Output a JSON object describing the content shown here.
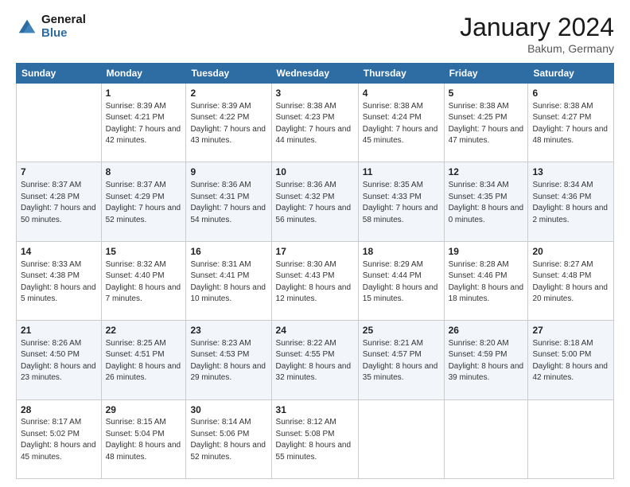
{
  "header": {
    "logo_line1": "General",
    "logo_line2": "Blue",
    "month": "January 2024",
    "location": "Bakum, Germany"
  },
  "weekdays": [
    "Sunday",
    "Monday",
    "Tuesday",
    "Wednesday",
    "Thursday",
    "Friday",
    "Saturday"
  ],
  "weeks": [
    [
      {
        "day": "",
        "sunrise": "",
        "sunset": "",
        "daylight": ""
      },
      {
        "day": "1",
        "sunrise": "Sunrise: 8:39 AM",
        "sunset": "Sunset: 4:21 PM",
        "daylight": "Daylight: 7 hours and 42 minutes."
      },
      {
        "day": "2",
        "sunrise": "Sunrise: 8:39 AM",
        "sunset": "Sunset: 4:22 PM",
        "daylight": "Daylight: 7 hours and 43 minutes."
      },
      {
        "day": "3",
        "sunrise": "Sunrise: 8:38 AM",
        "sunset": "Sunset: 4:23 PM",
        "daylight": "Daylight: 7 hours and 44 minutes."
      },
      {
        "day": "4",
        "sunrise": "Sunrise: 8:38 AM",
        "sunset": "Sunset: 4:24 PM",
        "daylight": "Daylight: 7 hours and 45 minutes."
      },
      {
        "day": "5",
        "sunrise": "Sunrise: 8:38 AM",
        "sunset": "Sunset: 4:25 PM",
        "daylight": "Daylight: 7 hours and 47 minutes."
      },
      {
        "day": "6",
        "sunrise": "Sunrise: 8:38 AM",
        "sunset": "Sunset: 4:27 PM",
        "daylight": "Daylight: 7 hours and 48 minutes."
      }
    ],
    [
      {
        "day": "7",
        "sunrise": "Sunrise: 8:37 AM",
        "sunset": "Sunset: 4:28 PM",
        "daylight": "Daylight: 7 hours and 50 minutes."
      },
      {
        "day": "8",
        "sunrise": "Sunrise: 8:37 AM",
        "sunset": "Sunset: 4:29 PM",
        "daylight": "Daylight: 7 hours and 52 minutes."
      },
      {
        "day": "9",
        "sunrise": "Sunrise: 8:36 AM",
        "sunset": "Sunset: 4:31 PM",
        "daylight": "Daylight: 7 hours and 54 minutes."
      },
      {
        "day": "10",
        "sunrise": "Sunrise: 8:36 AM",
        "sunset": "Sunset: 4:32 PM",
        "daylight": "Daylight: 7 hours and 56 minutes."
      },
      {
        "day": "11",
        "sunrise": "Sunrise: 8:35 AM",
        "sunset": "Sunset: 4:33 PM",
        "daylight": "Daylight: 7 hours and 58 minutes."
      },
      {
        "day": "12",
        "sunrise": "Sunrise: 8:34 AM",
        "sunset": "Sunset: 4:35 PM",
        "daylight": "Daylight: 8 hours and 0 minutes."
      },
      {
        "day": "13",
        "sunrise": "Sunrise: 8:34 AM",
        "sunset": "Sunset: 4:36 PM",
        "daylight": "Daylight: 8 hours and 2 minutes."
      }
    ],
    [
      {
        "day": "14",
        "sunrise": "Sunrise: 8:33 AM",
        "sunset": "Sunset: 4:38 PM",
        "daylight": "Daylight: 8 hours and 5 minutes."
      },
      {
        "day": "15",
        "sunrise": "Sunrise: 8:32 AM",
        "sunset": "Sunset: 4:40 PM",
        "daylight": "Daylight: 8 hours and 7 minutes."
      },
      {
        "day": "16",
        "sunrise": "Sunrise: 8:31 AM",
        "sunset": "Sunset: 4:41 PM",
        "daylight": "Daylight: 8 hours and 10 minutes."
      },
      {
        "day": "17",
        "sunrise": "Sunrise: 8:30 AM",
        "sunset": "Sunset: 4:43 PM",
        "daylight": "Daylight: 8 hours and 12 minutes."
      },
      {
        "day": "18",
        "sunrise": "Sunrise: 8:29 AM",
        "sunset": "Sunset: 4:44 PM",
        "daylight": "Daylight: 8 hours and 15 minutes."
      },
      {
        "day": "19",
        "sunrise": "Sunrise: 8:28 AM",
        "sunset": "Sunset: 4:46 PM",
        "daylight": "Daylight: 8 hours and 18 minutes."
      },
      {
        "day": "20",
        "sunrise": "Sunrise: 8:27 AM",
        "sunset": "Sunset: 4:48 PM",
        "daylight": "Daylight: 8 hours and 20 minutes."
      }
    ],
    [
      {
        "day": "21",
        "sunrise": "Sunrise: 8:26 AM",
        "sunset": "Sunset: 4:50 PM",
        "daylight": "Daylight: 8 hours and 23 minutes."
      },
      {
        "day": "22",
        "sunrise": "Sunrise: 8:25 AM",
        "sunset": "Sunset: 4:51 PM",
        "daylight": "Daylight: 8 hours and 26 minutes."
      },
      {
        "day": "23",
        "sunrise": "Sunrise: 8:23 AM",
        "sunset": "Sunset: 4:53 PM",
        "daylight": "Daylight: 8 hours and 29 minutes."
      },
      {
        "day": "24",
        "sunrise": "Sunrise: 8:22 AM",
        "sunset": "Sunset: 4:55 PM",
        "daylight": "Daylight: 8 hours and 32 minutes."
      },
      {
        "day": "25",
        "sunrise": "Sunrise: 8:21 AM",
        "sunset": "Sunset: 4:57 PM",
        "daylight": "Daylight: 8 hours and 35 minutes."
      },
      {
        "day": "26",
        "sunrise": "Sunrise: 8:20 AM",
        "sunset": "Sunset: 4:59 PM",
        "daylight": "Daylight: 8 hours and 39 minutes."
      },
      {
        "day": "27",
        "sunrise": "Sunrise: 8:18 AM",
        "sunset": "Sunset: 5:00 PM",
        "daylight": "Daylight: 8 hours and 42 minutes."
      }
    ],
    [
      {
        "day": "28",
        "sunrise": "Sunrise: 8:17 AM",
        "sunset": "Sunset: 5:02 PM",
        "daylight": "Daylight: 8 hours and 45 minutes."
      },
      {
        "day": "29",
        "sunrise": "Sunrise: 8:15 AM",
        "sunset": "Sunset: 5:04 PM",
        "daylight": "Daylight: 8 hours and 48 minutes."
      },
      {
        "day": "30",
        "sunrise": "Sunrise: 8:14 AM",
        "sunset": "Sunset: 5:06 PM",
        "daylight": "Daylight: 8 hours and 52 minutes."
      },
      {
        "day": "31",
        "sunrise": "Sunrise: 8:12 AM",
        "sunset": "Sunset: 5:08 PM",
        "daylight": "Daylight: 8 hours and 55 minutes."
      },
      {
        "day": "",
        "sunrise": "",
        "sunset": "",
        "daylight": ""
      },
      {
        "day": "",
        "sunrise": "",
        "sunset": "",
        "daylight": ""
      },
      {
        "day": "",
        "sunrise": "",
        "sunset": "",
        "daylight": ""
      }
    ]
  ]
}
